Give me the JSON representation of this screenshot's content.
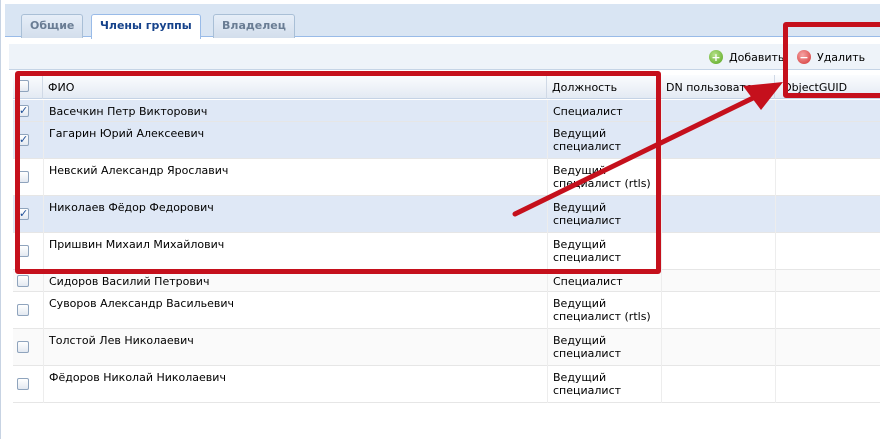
{
  "tabs": [
    {
      "label": "Общие"
    },
    {
      "label": "Члены группы"
    },
    {
      "label": "Владелец"
    }
  ],
  "toolbar": {
    "add_label": "Добавить",
    "delete_label": "Удалить"
  },
  "grid": {
    "columns": {
      "fio": "ФИО",
      "position": "Должность",
      "dn": "DN пользователя",
      "guid": "ObjectGUID"
    },
    "rows": [
      {
        "fio": "Васечкин Петр Викторович",
        "position": "Специалист",
        "checked": true
      },
      {
        "fio": "Гагарин Юрий Алексеевич",
        "position": "Ведущий специалист",
        "checked": true
      },
      {
        "fio": "Невский Александр Ярославич",
        "position": "Ведущий специалист (rtls)",
        "checked": false
      },
      {
        "fio": "Николаев Фёдор Федорович",
        "position": "Ведущий специалист",
        "checked": true
      },
      {
        "fio": "Пришвин Михаил Михайлович",
        "position": "Ведущий специалист",
        "checked": false
      },
      {
        "fio": "Сидоров Василий Петрович",
        "position": "Специалист",
        "checked": false
      },
      {
        "fio": "Суворов Александр Васильевич",
        "position": "Ведущий специалист (rtls)",
        "checked": false
      },
      {
        "fio": "Толстой Лев Николаевич",
        "position": "Ведущий специалист",
        "checked": false
      },
      {
        "fio": "Фёдоров Николай Николаевич",
        "position": "Ведущий специалист",
        "checked": false
      }
    ]
  },
  "colors": {
    "annotation": "#c5101c",
    "selected_row": "#dfe8f6"
  }
}
